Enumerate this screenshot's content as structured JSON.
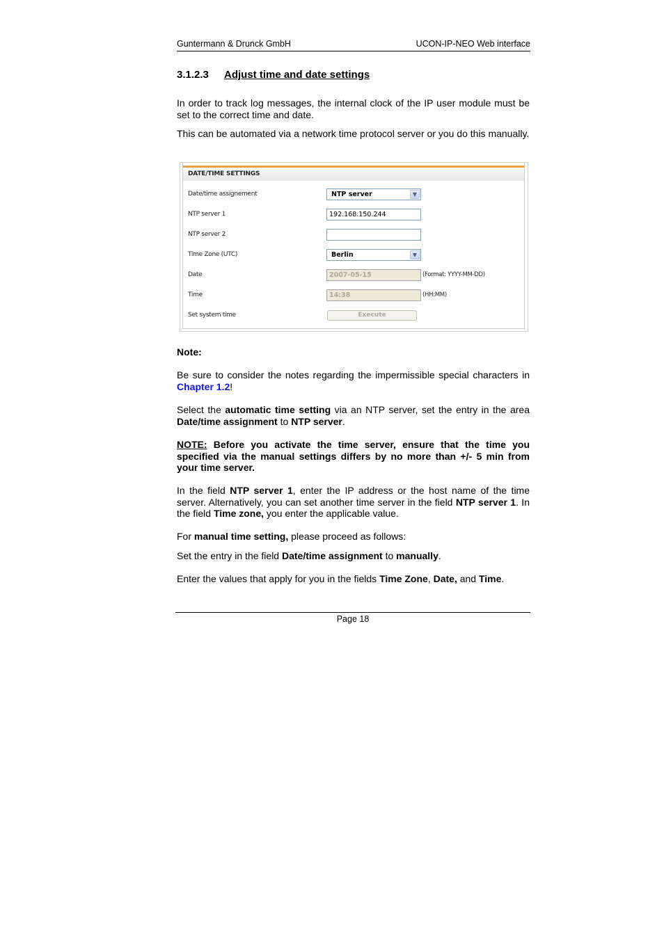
{
  "header": {
    "company": "Guntermann & Drunck GmbH",
    "product": "UCON-IP-NEO Web interface"
  },
  "section": {
    "number": "3.1.2.3",
    "title": "Adjust time and date settings"
  },
  "intro": {
    "p1": "In order to track log messages, the internal clock of the IP user module must be set to the correct time and date.",
    "p2": "This can be automated via a network time protocol server or you do this manually."
  },
  "screenshot": {
    "panel_title": "DATE/TIME SETTINGS",
    "rows": [
      {
        "label": "Date/time assignement",
        "type": "select",
        "value": "NTP server"
      },
      {
        "label": "NTP server 1",
        "type": "text",
        "value": "192.168.150.244"
      },
      {
        "label": "NTP server 2",
        "type": "text",
        "value": ""
      },
      {
        "label": "Time Zone (UTC)",
        "type": "select",
        "value": "Berlin"
      },
      {
        "label": "Date",
        "type": "text-disabled",
        "value": "2007-05-15",
        "hint": "(Format: YYYY-MM-DD)"
      },
      {
        "label": "Time",
        "type": "text-disabled",
        "value": "14:38",
        "hint": "(HH:MM)"
      },
      {
        "label": "Set system time",
        "type": "button",
        "value": "Execute"
      }
    ],
    "dropdown_icon": "chevron-down-icon",
    "accent_color": "#f0a040"
  },
  "note": {
    "heading": "Note:",
    "p1_text": "Be sure to consider the notes regarding the impermissible special characters in ",
    "p1_link": "Chapter 1.2",
    "p1_end": "!",
    "p2": {
      "t1": "Select the ",
      "b1": "automatic time setting",
      "t2": " via an NTP server, set the entry in the area ",
      "b2": "Date/time assignment",
      "t3": " to ",
      "b3": "NTP server",
      "t4": "."
    },
    "warning": {
      "label": "NOTE:",
      "text": " Before you activate the time server, ensure that the time you specified via the manual settings differs by no more than +/- 5 min from your time server."
    },
    "p3": {
      "t1": "In the field ",
      "b1": "NTP server 1",
      "t2": ", enter the IP address or the host name of the time server. Alternatively, you can set another time server in the field ",
      "b2": "NTP server 1",
      "t3": ". In the field ",
      "b3": "Time zone,",
      "t4": " you enter the applicable value."
    },
    "p4": {
      "t1": "For ",
      "b1": "manual time setting,",
      "t2": " please proceed as follows:"
    },
    "p5": {
      "t1": "Set the entry in the field ",
      "b1": "Date/time assignment",
      "t2": " to ",
      "b2": "manually",
      "t3": "."
    },
    "p6": {
      "t1": "Enter the values that apply for you in the fields ",
      "b1": "Time Zone",
      "t2": ", ",
      "b2": "Date,",
      "t3": " and ",
      "b3": "Time",
      "t4": "."
    }
  },
  "footer": {
    "page_label": "Page 18"
  },
  "colors": {
    "link": "#1414e6",
    "panel_accent": "#f0a040"
  }
}
